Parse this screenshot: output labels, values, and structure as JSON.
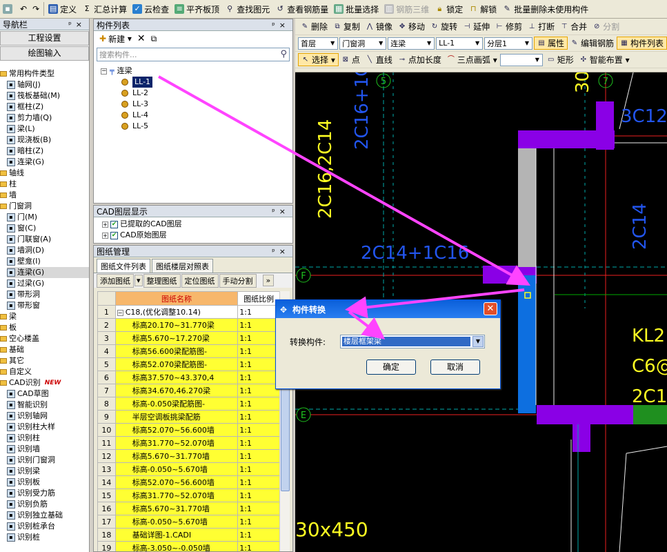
{
  "toolbar": {
    "items": [
      {
        "label": "定义"
      },
      {
        "label": "汇总计算"
      },
      {
        "label": "云检查"
      },
      {
        "label": "平齐板顶"
      },
      {
        "label": "查找图元"
      },
      {
        "label": "查看钢筋量"
      },
      {
        "label": "批量选择"
      },
      {
        "label": "钢筋三维"
      },
      {
        "label": "锁定"
      },
      {
        "label": "解锁"
      },
      {
        "label": "批量删除未使用构件"
      }
    ]
  },
  "nav": {
    "title": "导航栏",
    "buttons": [
      "工程设置",
      "绘图输入"
    ],
    "common_types": "常用构件类型",
    "common_items": [
      "轴网(J)",
      "筏板基础(M)",
      "框柱(Z)",
      "剪力墙(Q)",
      "梁(L)",
      "现浇板(B)",
      "暗柱(Z)",
      "连梁(G)"
    ],
    "folders_1": [
      "轴线",
      "柱",
      "墙"
    ],
    "door_window": "门窗洞",
    "door_items": [
      "门(M)",
      "窗(C)",
      "门联窗(A)",
      "墙洞(D)",
      "壁龛(I)",
      "连梁(G)",
      "过梁(G)",
      "带形洞",
      "带形窗"
    ],
    "folders_2": [
      "梁",
      "板",
      "空心楼盖",
      "基础",
      "其它",
      "自定义"
    ],
    "cad": "CAD识别",
    "new_badge": "NEW",
    "cad_items": [
      "CAD草图",
      "智能识别",
      "识别轴网",
      "识别柱大样",
      "识别柱",
      "识别墙",
      "识别门窗洞",
      "识别梁",
      "识别板",
      "识别受力筋",
      "识别负筋",
      "识别独立基础",
      "识别桩承台",
      "识别桩"
    ]
  },
  "complist": {
    "title": "构件列表",
    "new_label": "新建",
    "search_placeholder": "搜索构件...",
    "root": "连梁",
    "items": [
      "LL-1",
      "LL-2",
      "LL-3",
      "LL-4",
      "LL-5"
    ]
  },
  "cadlayer": {
    "title": "CAD图层显示",
    "items": [
      "已提取的CAD图层",
      "CAD原始图层"
    ]
  },
  "drawmgmt": {
    "title": "图纸管理",
    "tabs": [
      "图纸文件列表",
      "图纸楼层对照表"
    ],
    "tools": [
      "添加图纸",
      "整理图纸",
      "定位图纸",
      "手动分割"
    ],
    "col_name": "图纸名称",
    "col_scale": "图纸比例",
    "rows": [
      {
        "no": "1",
        "name": "C18,(优化调整10.14)",
        "scale": "1:1"
      },
      {
        "no": "2",
        "name": "标高20.170~31.770梁",
        "scale": "1:1"
      },
      {
        "no": "3",
        "name": "标高5.670~17.270梁",
        "scale": "1:1"
      },
      {
        "no": "4",
        "name": "标高56.600梁配筋图-",
        "scale": "1:1"
      },
      {
        "no": "5",
        "name": "标高52.070梁配筋图-",
        "scale": "1:1"
      },
      {
        "no": "6",
        "name": "标高37.570~43.370,4",
        "scale": "1:1"
      },
      {
        "no": "7",
        "name": "标高34.670,46.270梁",
        "scale": "1:1"
      },
      {
        "no": "8",
        "name": "标高-0.050梁配筋图-",
        "scale": "1:1"
      },
      {
        "no": "9",
        "name": "半层空调板挑梁配筋",
        "scale": "1:1"
      },
      {
        "no": "10",
        "name": "标高52.070~56.600墙",
        "scale": "1:1"
      },
      {
        "no": "11",
        "name": "标高31.770~52.070墙",
        "scale": "1:1"
      },
      {
        "no": "12",
        "name": "标高5.670~31.770墙",
        "scale": "1:1"
      },
      {
        "no": "13",
        "name": "标高-0.050~5.670墙",
        "scale": "1:1"
      },
      {
        "no": "14",
        "name": "标高52.070~56.600墙",
        "scale": "1:1"
      },
      {
        "no": "15",
        "name": "标高31.770~52.070墙",
        "scale": "1:1"
      },
      {
        "no": "16",
        "name": "标高5.670~31.770墙",
        "scale": "1:1"
      },
      {
        "no": "17",
        "name": "标高-0.050~5.670墙",
        "scale": "1:1"
      },
      {
        "no": "18",
        "name": "基础详图-1.CADI",
        "scale": "1:1"
      },
      {
        "no": "19",
        "name": "标高-3.050~-0.050墙",
        "scale": "1:1"
      }
    ]
  },
  "drawtools": {
    "row1": [
      "删除",
      "复制",
      "镜像",
      "移动",
      "旋转",
      "延伸",
      "修剪",
      "打断",
      "合并",
      "分割"
    ],
    "combos": [
      "首层",
      "门窗洞",
      "连梁",
      "LL-1",
      "分层1"
    ],
    "row2_right": [
      "属性",
      "编辑钢筋",
      "构件列表"
    ],
    "row3": [
      "选择",
      "点",
      "直线",
      "点加长度",
      "三点画弧",
      "矩形",
      "智能布置"
    ]
  },
  "cad": {
    "labels": [
      "2C16+1C",
      "2C16;2C14",
      "3C12",
      "2C14",
      "2C14+1C16",
      "KL2",
      "C6@",
      "2C1",
      "30x450",
      "30"
    ],
    "axis_numbers": [
      "5",
      "7"
    ],
    "axis_letters": [
      "F",
      "E"
    ]
  },
  "dialog": {
    "title": "构件转换",
    "label": "转换构件:",
    "value": "楼层框架梁",
    "ok": "确定",
    "cancel": "取消"
  },
  "colors": {
    "annotation": "#ff44ff",
    "cad_blue": "#0d6fe0",
    "cad_purple": "#8a00e6",
    "cad_yellow": "#ffff22",
    "cad_label_blue": "#2255ee"
  }
}
